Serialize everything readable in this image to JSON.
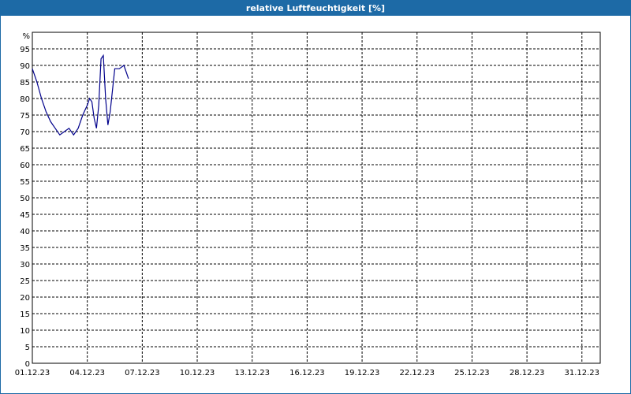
{
  "window": {
    "title": "relative Luftfeuchtigkeit [%]"
  },
  "chart_data": {
    "type": "line",
    "title": "relative Luftfeuchtigkeit [%]",
    "ylabel": "%",
    "ylim": [
      0,
      100
    ],
    "yticks": [
      0,
      5,
      10,
      15,
      20,
      25,
      30,
      35,
      40,
      45,
      50,
      55,
      60,
      65,
      70,
      75,
      80,
      85,
      90,
      95
    ],
    "xlim": [
      "01.12.23",
      "01.01.24"
    ],
    "xtick_labels": [
      "01.12.23",
      "04.12.23",
      "07.12.23",
      "10.12.23",
      "13.12.23",
      "16.12.23",
      "19.12.23",
      "22.12.23",
      "25.12.23",
      "28.12.23",
      "31.12.23"
    ],
    "grid": true,
    "series": [
      {
        "color": "#00008b",
        "x": [
          "01.12.23 00:00",
          "01.12.23 06:00",
          "01.12.23 12:00",
          "01.12.23 18:00",
          "02.12.23 00:00",
          "02.12.23 06:00",
          "02.12.23 12:00",
          "02.12.23 18:00",
          "03.12.23 00:00",
          "03.12.23 06:00",
          "03.12.23 12:00",
          "03.12.23 18:00",
          "04.12.23 00:00",
          "04.12.23 03:00",
          "04.12.23 06:00",
          "04.12.23 09:00",
          "04.12.23 12:00",
          "04.12.23 15:00",
          "04.12.23 18:00",
          "04.12.23 21:00",
          "05.12.23 00:00",
          "05.12.23 03:00",
          "05.12.23 06:00",
          "05.12.23 12:00",
          "05.12.23 18:00",
          "06.12.23 00:00",
          "06.12.23 06:00"
        ],
        "y": [
          89,
          85,
          80,
          76,
          73,
          71,
          69,
          70,
          71,
          69,
          71,
          75,
          78,
          80,
          79,
          74,
          71,
          78,
          92,
          93,
          80,
          72,
          76,
          89,
          89,
          90,
          86
        ]
      }
    ]
  }
}
